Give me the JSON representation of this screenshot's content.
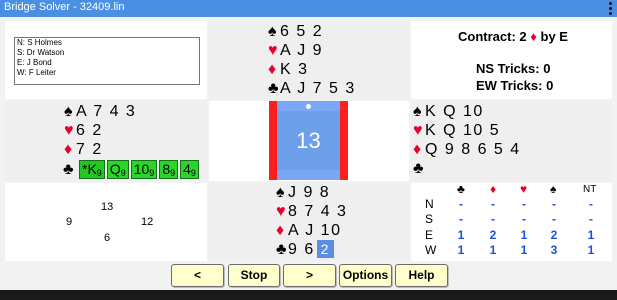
{
  "title": "Bridge Solver - 32409.lin",
  "players": [
    "N: S Holmes",
    "S: Dr Watson",
    "E: J Bond",
    "W: F Leiter"
  ],
  "contract": "Contract: 2",
  "contract_suit": "♦",
  "contract_by": "by E",
  "ns_tricks": "NS Tricks: 0",
  "ew_tricks": "EW Tricks: 0",
  "north": {
    "spades": "6 5 2",
    "hearts": "A J 9",
    "diamonds": "K 3",
    "clubs": "A J 7 5 3"
  },
  "west": {
    "spades": "A 7 4 3",
    "hearts": "6 2",
    "diamonds": "7 2"
  },
  "west_clubs": [
    {
      "rank": "*K",
      "sub": "9"
    },
    {
      "rank": "Q",
      "sub": "9"
    },
    {
      "rank": "10",
      "sub": "9"
    },
    {
      "rank": "8",
      "sub": "9"
    },
    {
      "rank": "4",
      "sub": "9"
    }
  ],
  "east": {
    "spades": "K Q 10",
    "hearts": "K Q 10 5",
    "diamonds": "Q 9 8 6 5 4",
    "clubs": ""
  },
  "south": {
    "spades": "J 9 8",
    "hearts": "8 7 4 3",
    "diamonds": "A J 10",
    "clubs": "9 6",
    "selected": "2"
  },
  "compass_number": "13",
  "trick": {
    "north": "13",
    "west": "9",
    "east": "12",
    "south": "6"
  },
  "dd_table": {
    "rows": [
      {
        "seat": "N",
        "values": [
          "-",
          "-",
          "-",
          "-",
          "-"
        ]
      },
      {
        "seat": "S",
        "values": [
          "-",
          "-",
          "-",
          "-",
          "-"
        ]
      },
      {
        "seat": "E",
        "values": [
          "1",
          "2",
          "1",
          "2",
          "1"
        ]
      },
      {
        "seat": "W",
        "values": [
          "1",
          "1",
          "1",
          "3",
          "1"
        ]
      }
    ],
    "nt_label": "NT"
  },
  "buttons": {
    "prev": "<",
    "stop": "Stop",
    "next": ">",
    "options": "Options",
    "help": "Help"
  },
  "colors": {
    "titlebar": "#4a90e2",
    "red_suit": "#e8002a",
    "card_green": "#2bd62b",
    "button_yellow": "#ffffcc",
    "blue_values": "#1a4fe0"
  }
}
